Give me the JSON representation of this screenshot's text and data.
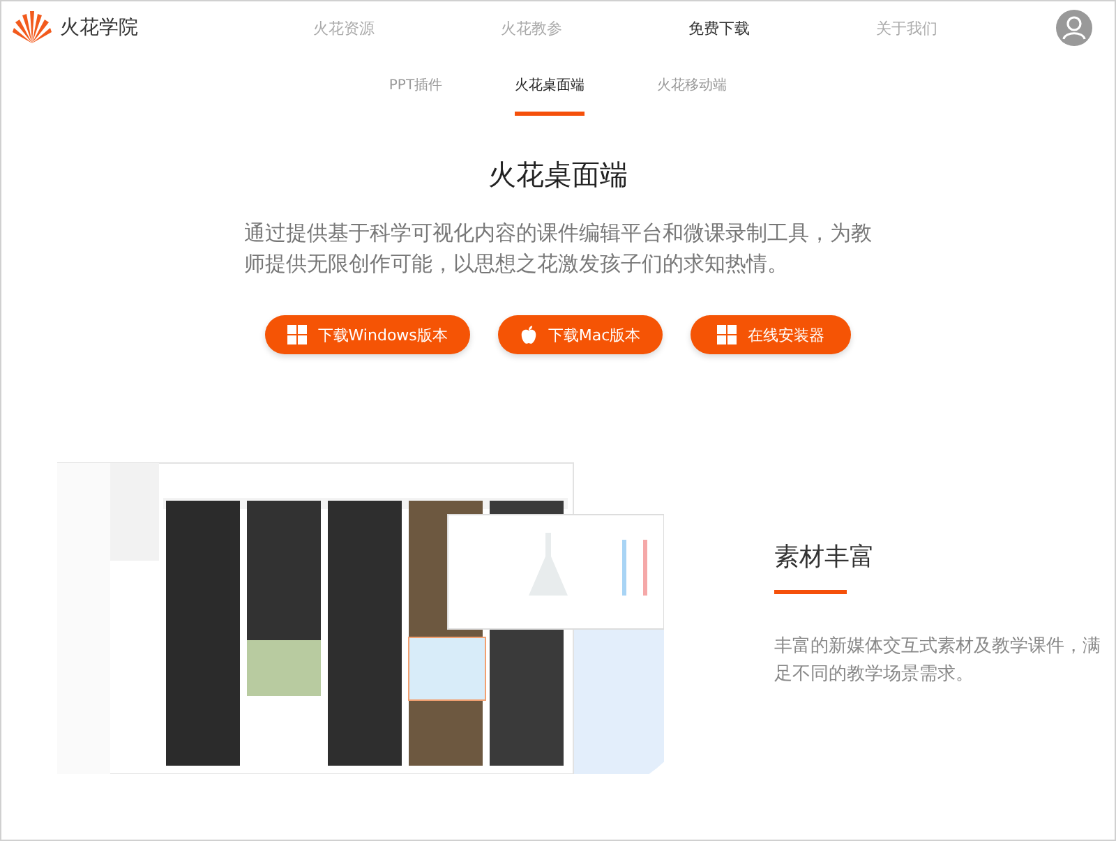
{
  "brand": {
    "name": "火花学院"
  },
  "nav": [
    {
      "label": "火花资源",
      "selected": false
    },
    {
      "label": "火花教参",
      "selected": false
    },
    {
      "label": "免费下载",
      "selected": true
    },
    {
      "label": "关于我们",
      "selected": false
    }
  ],
  "subnav": [
    {
      "label": "PPT插件",
      "selected": false
    },
    {
      "label": "火花桌面端",
      "selected": true
    },
    {
      "label": "火花移动端",
      "selected": false
    }
  ],
  "hero": {
    "title": "火花桌面端",
    "description": "通过提供基于科学可视化内容的课件编辑平台和微课录制工具，为教师提供无限创作可能，以思想之花激发孩子们的求知热情。"
  },
  "buttons": [
    {
      "label": "下载Windows版本",
      "kind": "windows"
    },
    {
      "label": "下载Mac版本",
      "kind": "apple"
    },
    {
      "label": "在线安装器",
      "kind": "windows"
    }
  ],
  "feature": {
    "title": "素材丰富",
    "description": "丰富的新媒体交互式素材及教学课件，满足不同的教学场景需求。"
  }
}
